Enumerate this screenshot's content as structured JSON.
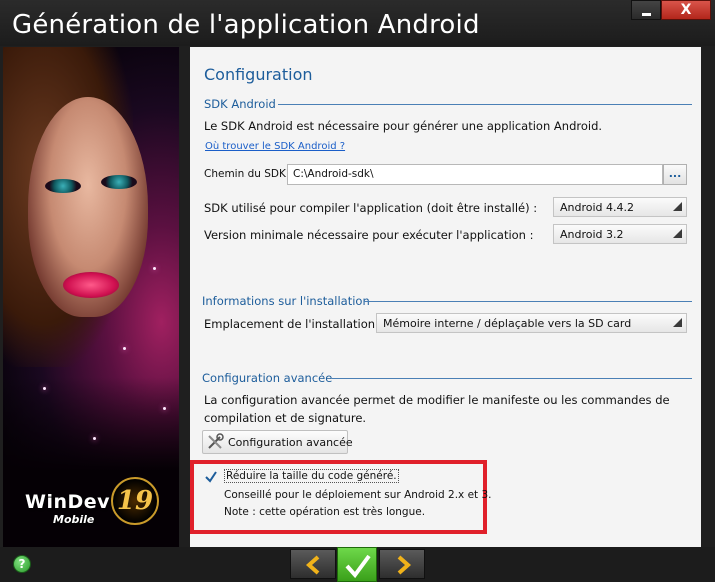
{
  "window": {
    "title": "Génération de l'application Android",
    "close_label": "X"
  },
  "logo": {
    "brand": "WinDev",
    "edition": "Mobile",
    "version": "19"
  },
  "page": {
    "title": "Configuration"
  },
  "sdk": {
    "group_title": "SDK Android",
    "description": "Le SDK Android est nécessaire pour générer une application Android.",
    "link": "Où trouver le SDK Android ?",
    "path_label": "Chemin du SDK :",
    "path_value": "C:\\Android-sdk\\",
    "browse_label": "...",
    "compile_label": "SDK utilisé pour compiler l'application (doit être installé) :",
    "compile_value": "Android 4.4.2",
    "min_label": "Version minimale nécessaire pour exécuter l'application :",
    "min_value": "Android 3.2"
  },
  "install": {
    "group_title": "Informations sur l'installation",
    "location_label": "Emplacement de l'installation :",
    "location_value": "Mémoire interne / déplaçable vers la SD card"
  },
  "advanced": {
    "group_title": "Configuration avancée",
    "description_line1": "La configuration avancée permet de modifier le manifeste ou les commandes de",
    "description_line2": "compilation et de signature.",
    "button_label": "Configuration avancée",
    "reduce_checked": true,
    "reduce_label": "Réduire la taille du code généré.",
    "note_line1": "Conseillé pour le déploiement sur Android 2.x et 3.",
    "note_line2": "Note : cette opération est très longue."
  },
  "footer": {
    "help_label": "?"
  },
  "colors": {
    "accent": "#1d5d9b",
    "highlight": "#e0202a",
    "ok_green": "#4cbb2a",
    "nav_arrow": "#f0b21a"
  }
}
